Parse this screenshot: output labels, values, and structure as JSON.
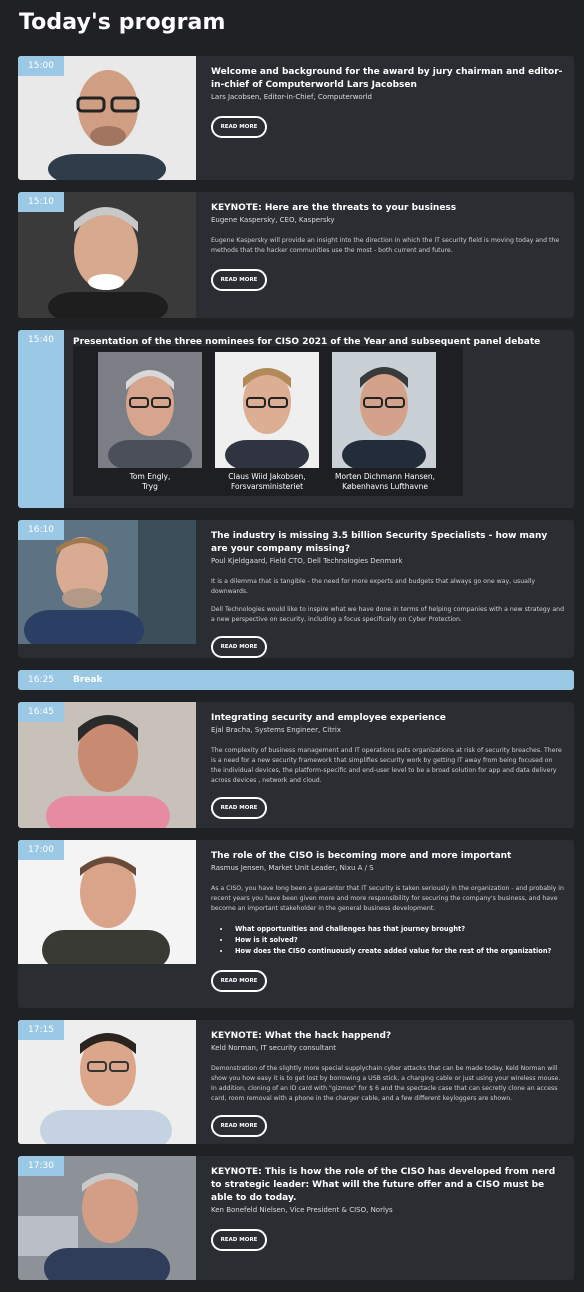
{
  "page_title": "Today's program",
  "read_more": "READ MORE",
  "sessions": [
    {
      "time": "15:00",
      "title": "Welcome and background for the award by jury chairman and editor-in-chief of Computerworld Lars Jacobsen",
      "speaker": "Lars Jacobsen, Editor-in-Chief, Computerworld",
      "desc": ""
    },
    {
      "time": "15:10",
      "title": "KEYNOTE: Here are the threats to your business",
      "speaker": "Eugene Kaspersky, CEO, Kaspersky",
      "desc": "Eugene Kaspersky will provide an insight into the direction in which the IT security field is moving today and the methods that the hacker communities use the most - both current and future."
    },
    {
      "time": "15:40",
      "title": "Presentation of the three nominees for CISO 2021 of the Year and subsequent panel debate",
      "nominees": [
        {
          "name": "Tom Engly,",
          "org": "Tryg"
        },
        {
          "name": "Claus Wiid Jakobsen,",
          "org": "Forsvarsministeriet"
        },
        {
          "name": "Morten Dichmann Hansen,",
          "org": "Københavns Lufthavne"
        }
      ]
    },
    {
      "time": "16:10",
      "title": "The industry is missing 3.5 billion Security Specialists - how many are your company missing?",
      "speaker": "Poul Kjeldgaard, Field CTO, Dell Technologies Denmark",
      "desc": "It is a dilemma that is tangible - the need for more experts and budgets that always go one way, usually downwards.",
      "desc2": "Dell Technologies would like to inspire what we have done in terms of helping companies with a new strategy and a new perspective on security, including a focus specifically on Cyber Protection."
    },
    {
      "time": "16:25",
      "title": "Break"
    },
    {
      "time": "16:45",
      "title": "Integrating security and employee experience",
      "speaker": "Ejal Bracha, Systems Engineer, Citrix",
      "desc": "The complexity of business management and IT operations puts organizations at risk of security breaches. There is a need for a new security framework that simplifies security work by getting IT away from being focused on the individual devices, the platform-specific and end-user level to be a broad solution for app and data delivery across devices , network and cloud."
    },
    {
      "time": "17:00",
      "title": "The role of the CISO is becoming more and more important",
      "speaker": "Rasmus Jensen, Market Unit Leader, Nixu A / S",
      "desc": "As a CISO, you have long been a guarantor that IT security is taken seriously in the organization - and probably in recent years you have been given more and more responsibility for securing the company's business, and have become an important stakeholder in the general business development.",
      "bullets": [
        "What opportunities and challenges has that journey brought?",
        "How is it solved?",
        "How does the CISO continuously create added value for the rest of the organization?"
      ]
    },
    {
      "time": "17:15",
      "title": "KEYNOTE: What the hack happend?",
      "speaker": "Keld Norman, IT security consultant",
      "desc": "Demonstration of the slightly more special supplychain cyber attacks that can be made today. Keld Norman will show you how easy it is to get lost by borrowing a USB stick, a charging cable or just using your wireless mouse. In addition, cloning of an ID card with \"gizmos\" for $ 6 and the spectacle case that can secretly clone an access card, room removal with a phone in the charger cable, and a few different keyloggers are shown."
    },
    {
      "time": "17:30",
      "title": "KEYNOTE: This is how the role of the CISO has developed from nerd to strategic leader: What will the future offer and a CISO must be able to do today.",
      "speaker": "Ken Bonefeld Nielsen, Vice President & CISO, Norlys",
      "desc": ""
    }
  ]
}
